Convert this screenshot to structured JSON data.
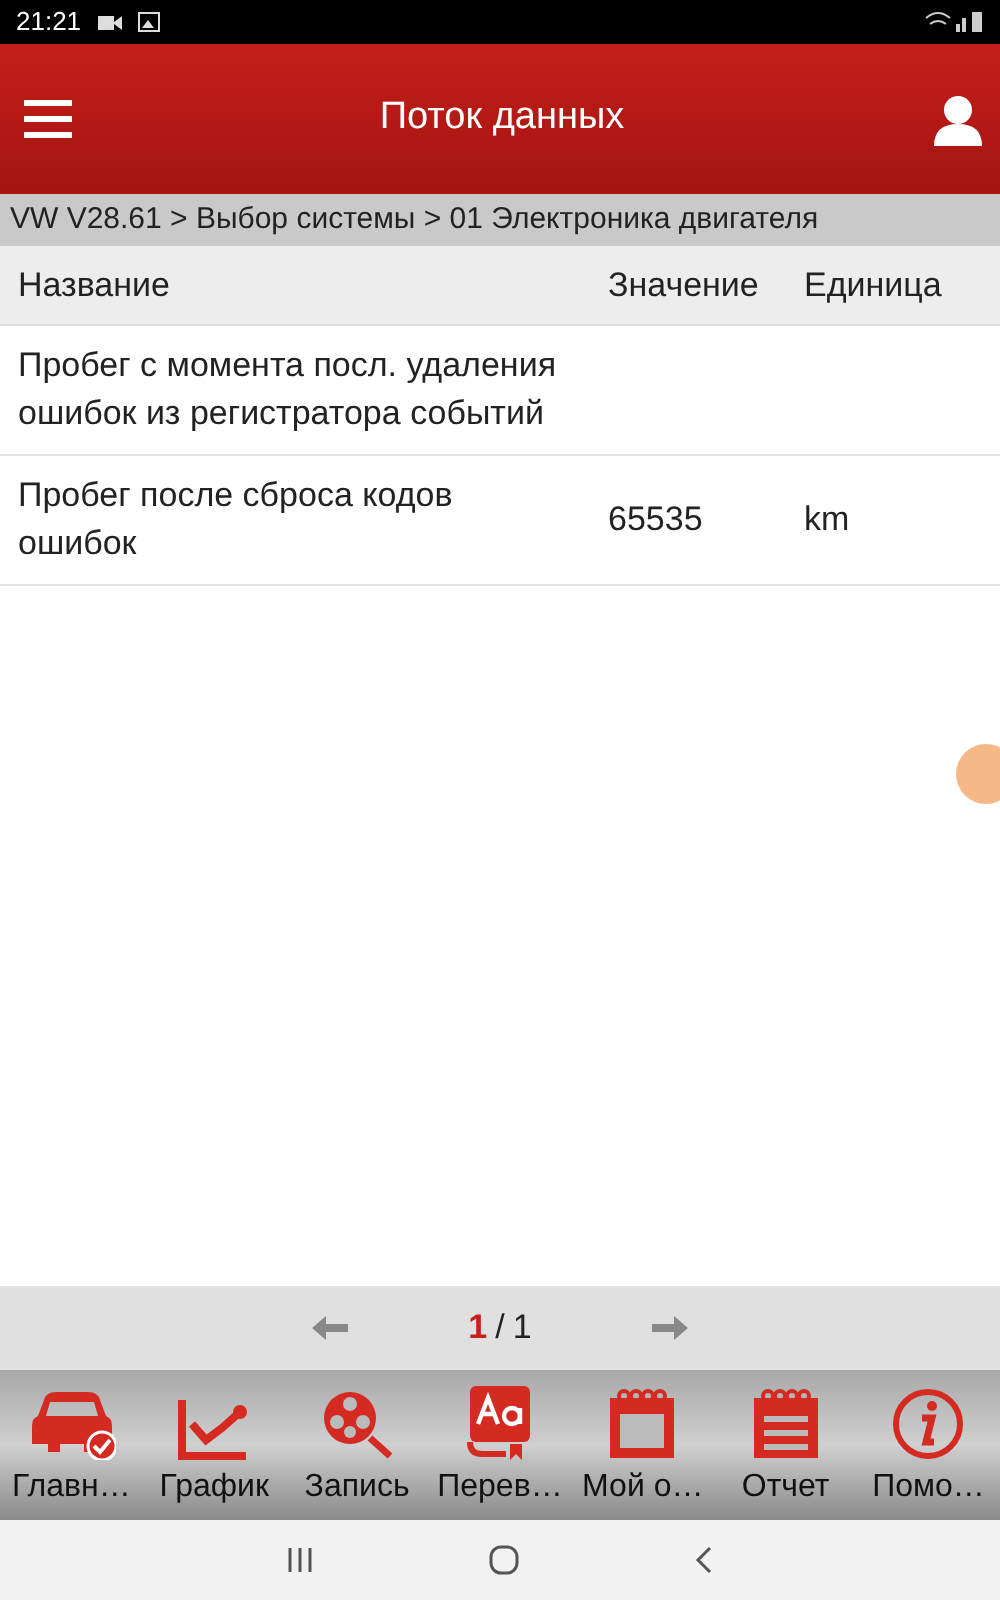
{
  "status_bar": {
    "time": "21:21"
  },
  "header": {
    "title": "Поток данных"
  },
  "breadcrumb": "VW V28.61 > Выбор системы > 01 Электроника двигателя",
  "table": {
    "columns": [
      "Название",
      "Значение",
      "Единица"
    ],
    "rows": [
      {
        "name": "Пробег с момента посл. удаления ошибок из регистратора событий",
        "value": "",
        "unit": ""
      },
      {
        "name": "Пробег после сброса кодов ошибок",
        "value": "65535",
        "unit": "km"
      }
    ]
  },
  "pager": {
    "current": "1",
    "separator": "/",
    "total": "1"
  },
  "toolbar": [
    {
      "kind": "car",
      "label": "Главн…"
    },
    {
      "kind": "graph",
      "label": "График"
    },
    {
      "kind": "record",
      "label": "Запись"
    },
    {
      "kind": "translate",
      "label": "Перев…"
    },
    {
      "kind": "calendar",
      "label": "Мой о…"
    },
    {
      "kind": "report",
      "label": "Отчет"
    },
    {
      "kind": "help",
      "label": "Помо…"
    }
  ]
}
